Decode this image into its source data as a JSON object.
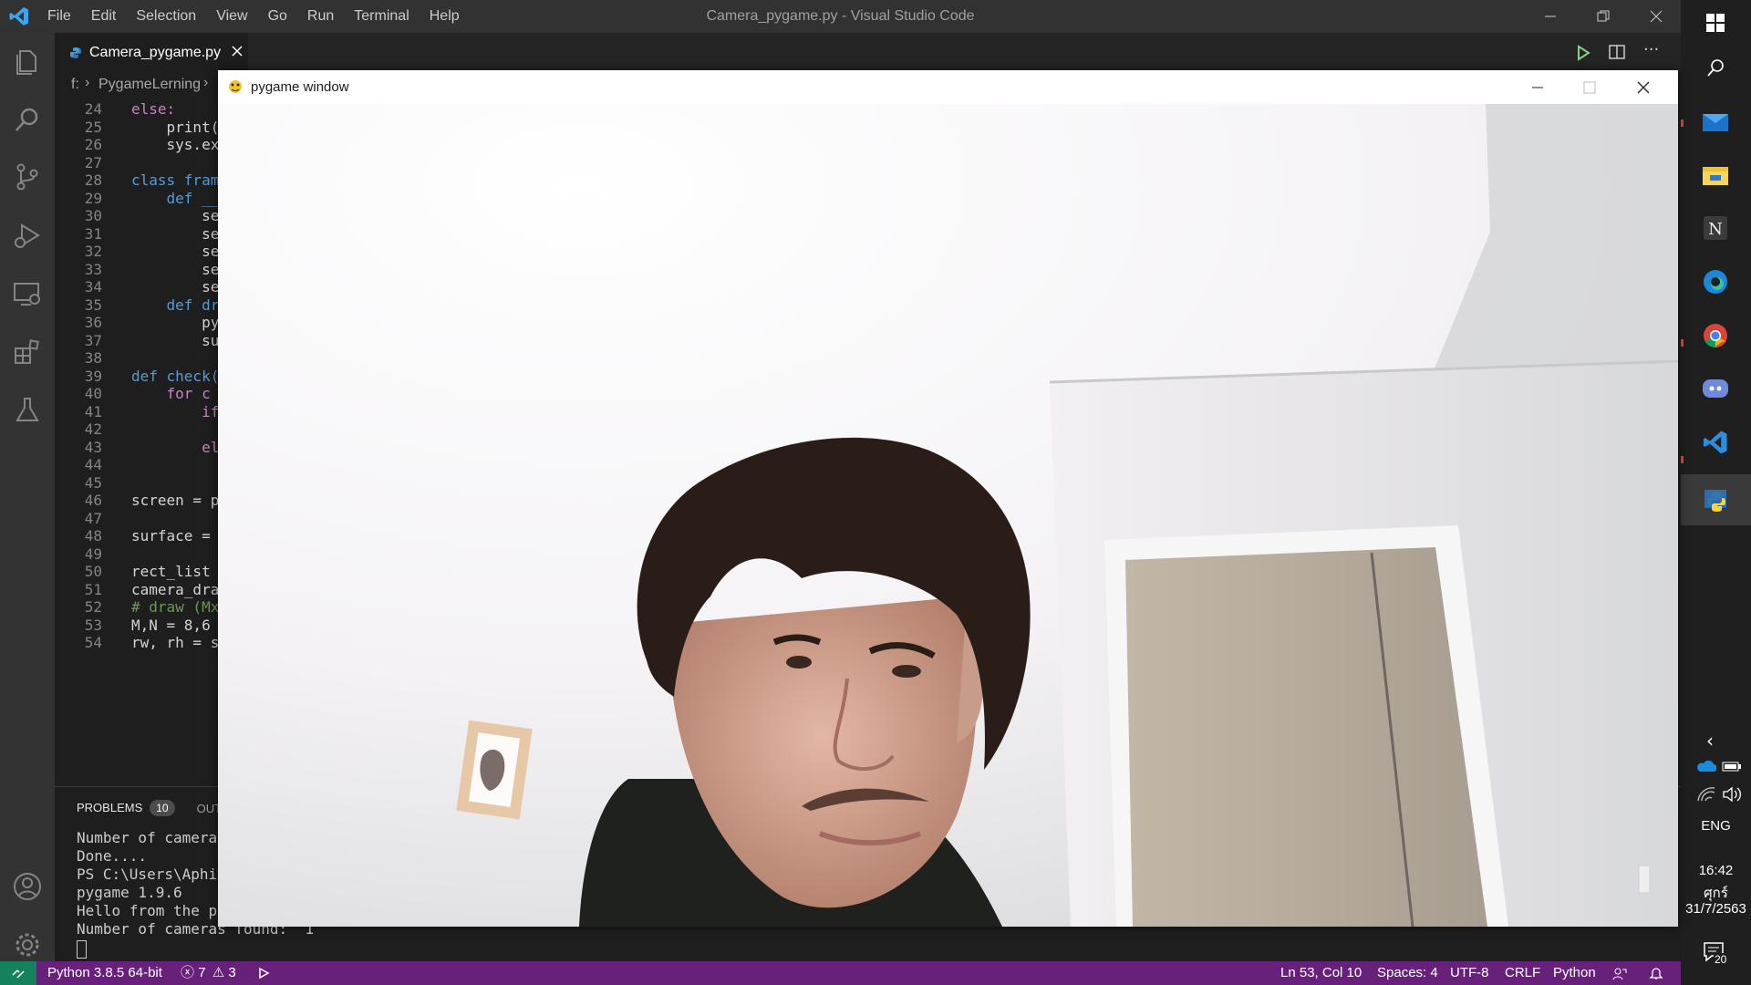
{
  "titlebar": {
    "menu": [
      "File",
      "Edit",
      "Selection",
      "View",
      "Go",
      "Run",
      "Terminal",
      "Help"
    ],
    "window_title": "Camera_pygame.py - Visual Studio Code"
  },
  "editor": {
    "tab_label": "Camera_pygame.py",
    "breadcrumb": [
      "f:",
      "PygameLerning"
    ],
    "lines": [
      {
        "n": "24",
        "code": "else:"
      },
      {
        "n": "25",
        "code": "    print("
      },
      {
        "n": "26",
        "code": "    sys.ex"
      },
      {
        "n": "27",
        "code": ""
      },
      {
        "n": "28",
        "code": "class fram"
      },
      {
        "n": "29",
        "code": "    def __"
      },
      {
        "n": "30",
        "code": "        se"
      },
      {
        "n": "31",
        "code": "        se"
      },
      {
        "n": "32",
        "code": "        se"
      },
      {
        "n": "33",
        "code": "        se"
      },
      {
        "n": "34",
        "code": "        se"
      },
      {
        "n": "35",
        "code": "    def dr"
      },
      {
        "n": "36",
        "code": "        py"
      },
      {
        "n": "37",
        "code": "        su"
      },
      {
        "n": "38",
        "code": ""
      },
      {
        "n": "39",
        "code": "def check("
      },
      {
        "n": "40",
        "code": "    for c"
      },
      {
        "n": "41",
        "code": "        if"
      },
      {
        "n": "42",
        "code": ""
      },
      {
        "n": "43",
        "code": "        el"
      },
      {
        "n": "44",
        "code": ""
      },
      {
        "n": "45",
        "code": ""
      },
      {
        "n": "46",
        "code": "screen = p"
      },
      {
        "n": "47",
        "code": ""
      },
      {
        "n": "48",
        "code": "surface = "
      },
      {
        "n": "49",
        "code": ""
      },
      {
        "n": "50",
        "code": "rect_list "
      },
      {
        "n": "51",
        "code": "camera_dra"
      },
      {
        "n": "52",
        "code": "# draw (Mx"
      },
      {
        "n": "53",
        "code": "M,N = 8,6"
      },
      {
        "n": "54",
        "code": "rw, rh = s"
      }
    ]
  },
  "panel": {
    "problems_label": "PROBLEMS",
    "problems_count": "10",
    "output_label": "OUT",
    "terminal_lines": [
      "Number of cameras",
      "Done....",
      "PS C:\\Users\\Aphis",
      "pygame 1.9.6",
      "Hello from the py",
      "Number of cameras found:  1"
    ]
  },
  "statusbar": {
    "python": "Python 3.8.5 64-bit",
    "errors": "7",
    "warnings": "3",
    "position": "Ln 53, Col 10",
    "spaces": "Spaces: 4",
    "encoding": "UTF-8",
    "eol": "CRLF",
    "language": "Python"
  },
  "pygame_window": {
    "title": "pygame window"
  },
  "taskbar": {
    "language": "ENG",
    "time": "16:42",
    "day": "ศุกร์",
    "date": "31/7/2563",
    "notifications": "20"
  },
  "colors": {
    "statusbar": "#68217a",
    "remote": "#16825d",
    "activitybar": "#333333",
    "editor_bg": "#1e1e1e"
  }
}
